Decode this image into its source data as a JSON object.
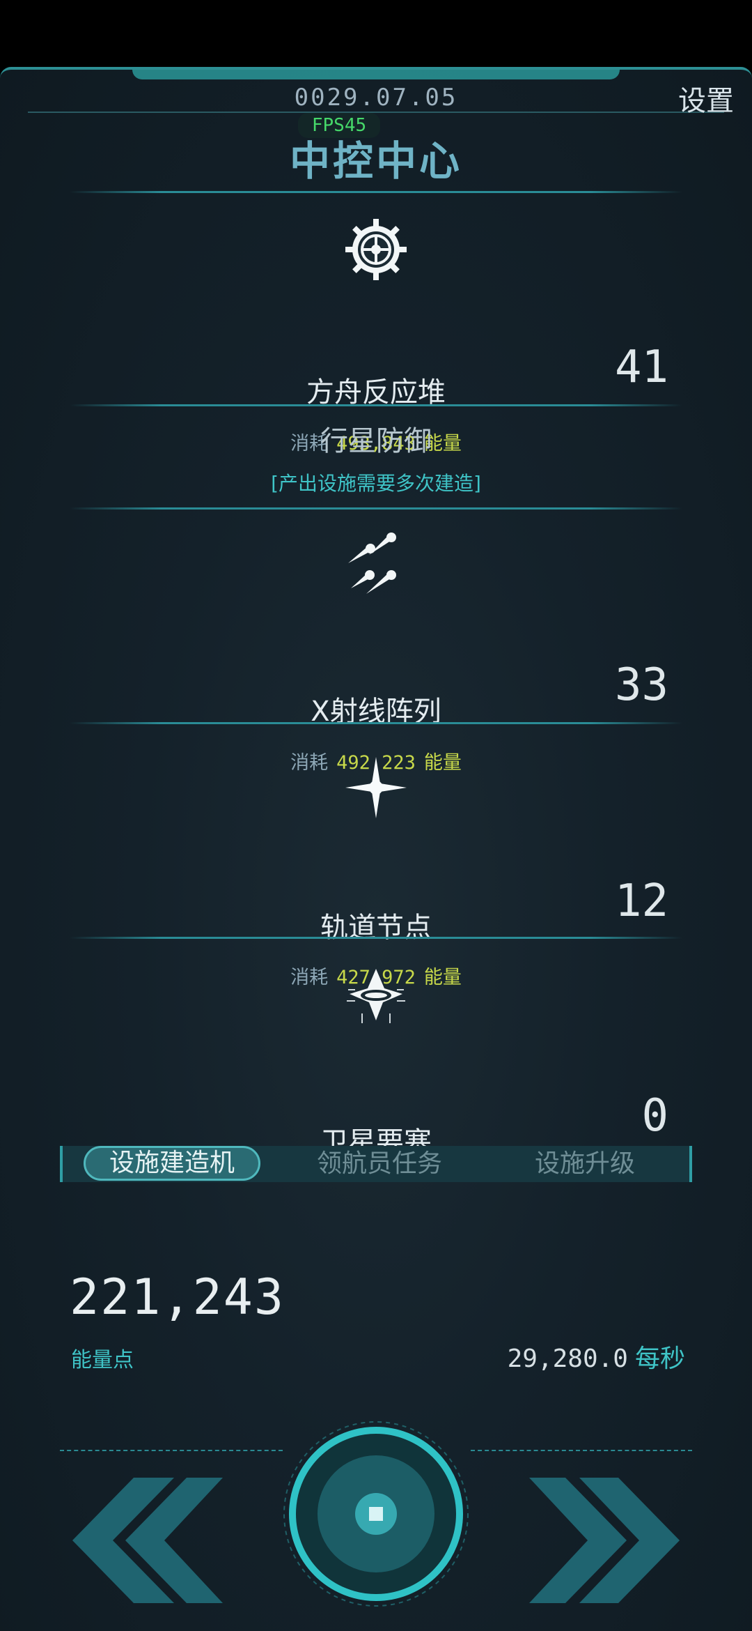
{
  "header": {
    "date": "0029.07.05",
    "settings_label": "设置",
    "fps": "FPS45",
    "title": "中控中心"
  },
  "facilities": [
    {
      "name": "方舟反应堆",
      "cost_label": "消耗",
      "cost": "493,843",
      "cost_unit": "能量",
      "count": "41",
      "icon": "gear-reactor-icon"
    },
    {
      "name": "X射线阵列",
      "cost_label": "消耗",
      "cost": "492,223",
      "cost_unit": "能量",
      "count": "33",
      "icon": "xray-missiles-icon"
    },
    {
      "name": "轨道节点",
      "cost_label": "消耗",
      "cost": "427,972",
      "cost_unit": "能量",
      "count": "12",
      "icon": "star-node-icon"
    },
    {
      "name": "卫星要塞",
      "count": "0",
      "icon": "satellite-fortress-icon"
    }
  ],
  "defense": {
    "title": "行星防御",
    "subtitle": "[产出设施需要多次建造]"
  },
  "tabs": [
    {
      "label": "设施建造机",
      "active": true
    },
    {
      "label": "领航员任务",
      "active": false
    },
    {
      "label": "设施升级",
      "active": false
    }
  ],
  "energy": {
    "value": "221,243",
    "label": "能量点",
    "rate": "29,280.0",
    "rate_unit": "每秒"
  },
  "colors": {
    "accent": "#3fc4c7",
    "cost": "#c8d94a",
    "fps": "#46d86a",
    "panel": "#14212a"
  }
}
